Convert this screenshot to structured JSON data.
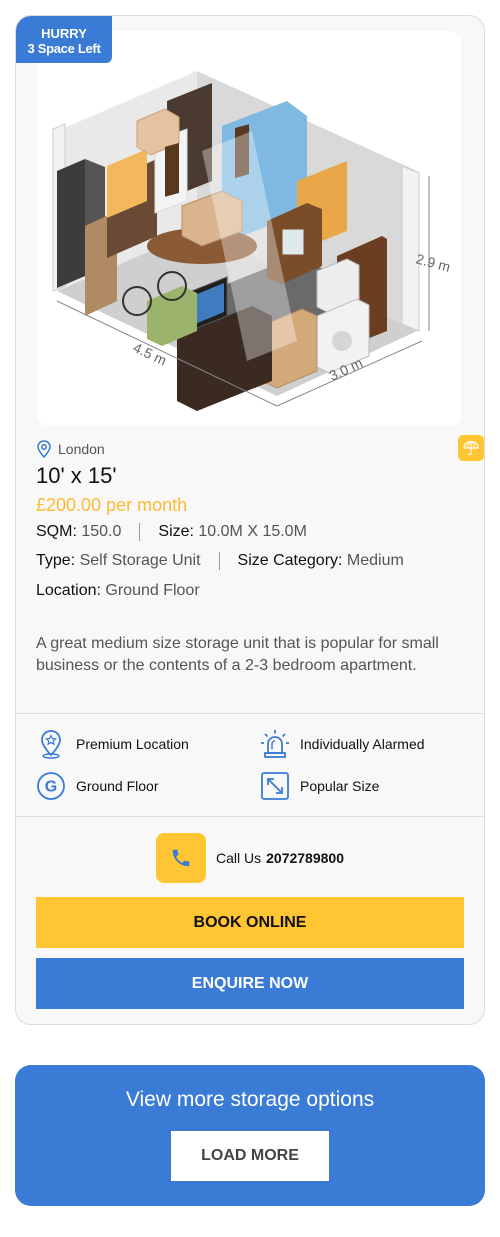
{
  "badge": {
    "line1": "HURRY",
    "line2": "3 Space Left"
  },
  "unit_image": {
    "dim_width": "4.5 m",
    "dim_depth": "3.0 m",
    "dim_height": "2.9 m"
  },
  "location": {
    "city": "London"
  },
  "unit": {
    "size": "10' x 15'",
    "price": "£200.00 per month",
    "sqm_label": "SQM",
    "sqm_value": "150.0",
    "size_label": "Size",
    "size_value": "10.0M X 15.0M",
    "type_label": "Type",
    "type_value": "Self Storage Unit",
    "category_label": "Size Category",
    "category_value": "Medium",
    "location_label": "Location",
    "location_value": "Ground Floor",
    "description": "A great medium size storage unit that is popular for small business or the contents of a 2-3 bedroom apartment."
  },
  "features": [
    {
      "label": "Premium Location",
      "icon": "premium-location-icon"
    },
    {
      "label": "Individually Alarmed",
      "icon": "alarm-icon"
    },
    {
      "label": "Ground Floor",
      "icon": "ground-floor-icon"
    },
    {
      "label": "Popular Size",
      "icon": "expand-icon"
    }
  ],
  "call": {
    "label": "Call Us",
    "number": "2072789800"
  },
  "buttons": {
    "book": "BOOK ONLINE",
    "enquire": "ENQUIRE NOW"
  },
  "more": {
    "title": "View more storage options",
    "button": "LOAD MORE"
  },
  "colors": {
    "accent_blue": "#3a7bd5",
    "accent_yellow": "#ffc533",
    "price": "#ffba33"
  }
}
